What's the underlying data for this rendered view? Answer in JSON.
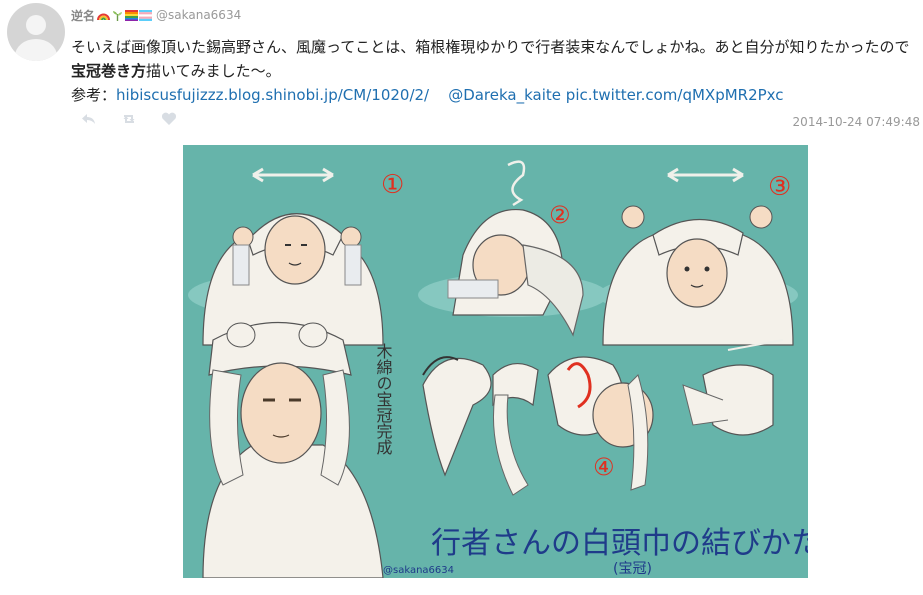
{
  "user": {
    "name": "逆名",
    "handle": "@sakana6634",
    "flags": [
      "rainbow-icon",
      "plant-icon",
      "rainbow-flag-icon",
      "trans-flag-icon"
    ]
  },
  "post": {
    "text_main": "そいえば画像頂いた錫高野さん、風魔ってことは、箱根権現ゆかりで行者装束なんでしょかね。あと自分が知りたかったので",
    "text_em": "宝冠巻き方",
    "text_after": "描いてみました〜。",
    "ref_label": "参考：",
    "link_1": "hibiscusfujizzz.blog.shinobi.jp/CM/1020/2/",
    "link_2": "@Dareka_kaite",
    "link_3": "pic.twitter.com/qMXpMR2Pxc",
    "timestamp": "2014-10-24 07:49:48"
  },
  "actions": [
    "reply-icon",
    "retweet-icon",
    "like-icon"
  ],
  "illustration": {
    "step_1": "①",
    "step_2": "②",
    "step_3": "③",
    "step_4": "④",
    "vertical_caption": "木綿の宝冠完成",
    "title": "行者さんの白頭巾の結びかた",
    "subtitle": "(宝冠)",
    "signature": "@sakana6634"
  },
  "colors": {
    "illustration_bg": "#66b4aa",
    "link": "#1f6fb0",
    "accent_red": "#e03020",
    "ink_blue": "#1f3b8a"
  }
}
